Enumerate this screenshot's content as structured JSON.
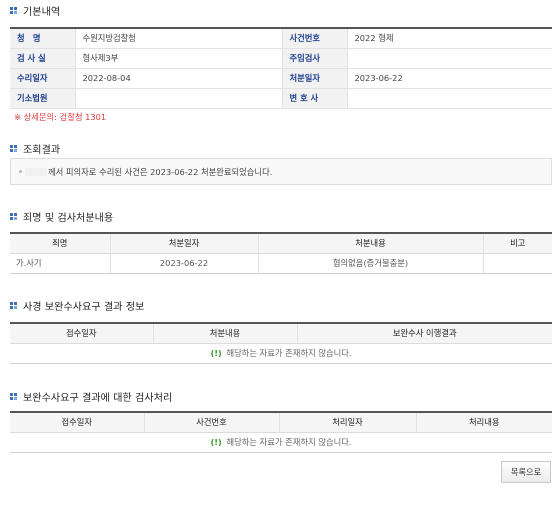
{
  "basic": {
    "title": "기본내역",
    "rows": [
      [
        {
          "label": "청　명",
          "value": "수원지방검찰청"
        },
        {
          "label": "사건번호",
          "value": "2022 형제"
        }
      ],
      [
        {
          "label": "검 사 실",
          "value": "형사제3부"
        },
        {
          "label": "주임검사",
          "value": ""
        }
      ],
      [
        {
          "label": "수리일자",
          "value": "2022-08-04"
        },
        {
          "label": "처분일자",
          "value": "2023-06-22"
        }
      ],
      [
        {
          "label": "기소법원",
          "value": ""
        },
        {
          "label": "변 호 사",
          "value": ""
        }
      ]
    ],
    "note": "※ 상세문의: 검찰청 1301"
  },
  "inquiry": {
    "title": "조회결과",
    "text": "께서 피의자로 수리된 사건은 2023-06-22 처분완료되었습니다."
  },
  "charges": {
    "title": "죄명 및 검사처분내용",
    "headers": [
      "죄명",
      "처분일자",
      "처분내용",
      "비고"
    ],
    "rows": [
      [
        "가.사기",
        "2023-06-22",
        "혐의없음(증거불충분)",
        ""
      ]
    ]
  },
  "supplement": {
    "title": "사경 보완수사요구 결과 정보",
    "headers": [
      "접수일자",
      "처분내용",
      "보완수사 이행결과"
    ],
    "empty_mark": "(!)",
    "empty_text": "해당하는 자료가 존재하지 않습니다."
  },
  "prosecutor": {
    "title": "보완수사요구 결과에 대한 검사처리",
    "headers": [
      "접수일자",
      "사건번호",
      "처리일자",
      "처리내용"
    ],
    "empty_mark": "(!)",
    "empty_text": "해당하는 자료가 존재하지 않습니다."
  },
  "list_button": "목록으로",
  "colors": {
    "accent": "#3f6fb5",
    "label": "#1e3f8f",
    "note": "#d93a3a",
    "empty_mark": "#3a9a2a"
  }
}
